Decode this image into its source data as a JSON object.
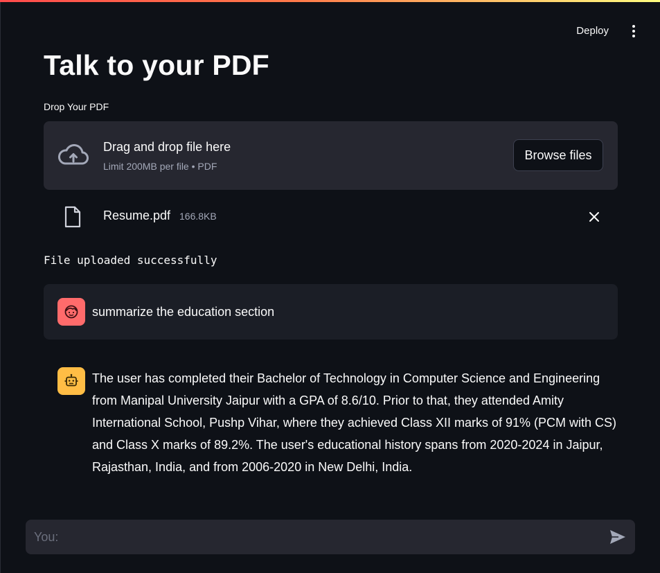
{
  "header": {
    "deploy_label": "Deploy",
    "menu_icon": "kebab-menu-icon"
  },
  "page": {
    "title": "Talk to your PDF"
  },
  "uploader": {
    "label": "Drop Your PDF",
    "dropzone_title": "Drag and drop file here",
    "dropzone_subtitle": "Limit 200MB per file • PDF",
    "browse_label": "Browse files",
    "icon": "cloud-upload-icon"
  },
  "file": {
    "name": "Resume.pdf",
    "size": "166.8KB",
    "icon": "file-icon",
    "remove_icon": "close-icon"
  },
  "status": {
    "text": "File uploaded successfully"
  },
  "chat": {
    "messages": [
      {
        "role": "user",
        "avatar_icon": "user-face-icon",
        "avatar_color": "#ff6b6b",
        "text": "summarize the education section"
      },
      {
        "role": "assistant",
        "avatar_icon": "robot-icon",
        "avatar_color": "#ffbd45",
        "text": "The user has completed their Bachelor of Technology in Computer Science and Engineering from Manipal University Jaipur with a GPA of 8.6/10. Prior to that, they attended Amity International School, Pushp Vihar, where they achieved Class XII marks of 91% (PCM with CS) and Class X marks of 89.2%. The user's educational history spans from 2020-2024 in Jaipur, Rajasthan, India, and from 2006-2020 in New Delhi, India."
      }
    ],
    "input_placeholder": "You:",
    "input_value": "",
    "send_icon": "send-icon"
  },
  "colors": {
    "background": "#0e1117",
    "surface": "#262730",
    "user_avatar": "#ff6b6b",
    "assistant_avatar": "#ffbd45",
    "accent_gradient_start": "#ff4b4b",
    "accent_gradient_end": "#fffd80"
  }
}
